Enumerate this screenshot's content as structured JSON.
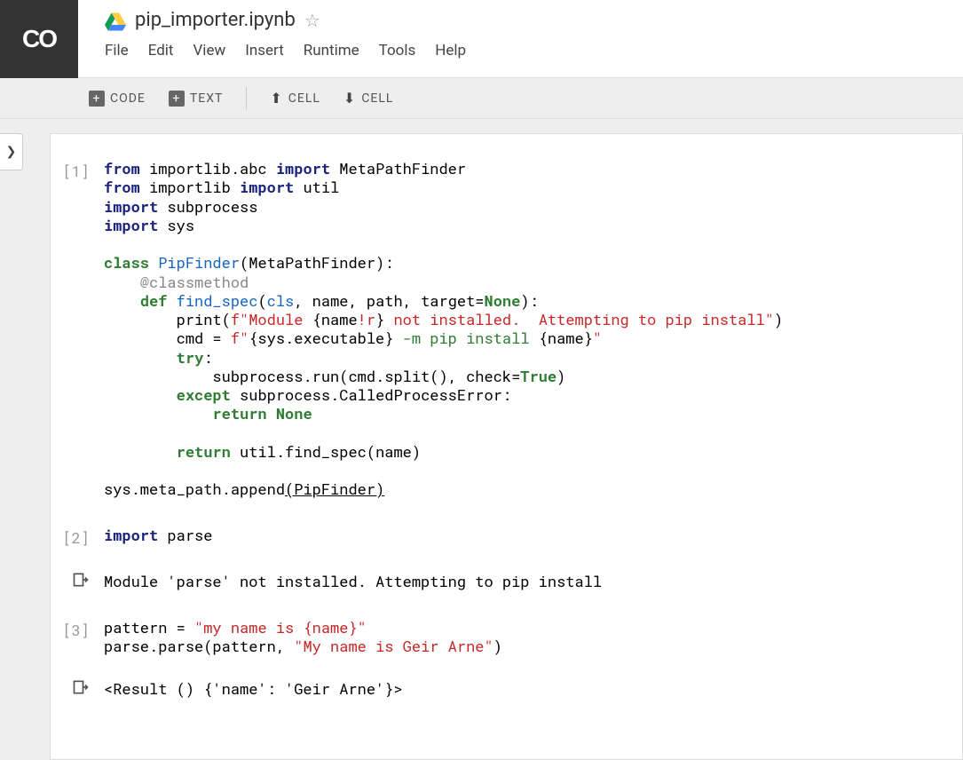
{
  "header": {
    "logo_text": "CO",
    "notebook_title": "pip_importer.ipynb"
  },
  "menu": {
    "file": "File",
    "edit": "Edit",
    "view": "View",
    "insert": "Insert",
    "runtime": "Runtime",
    "tools": "Tools",
    "help": "Help"
  },
  "toolbar": {
    "code": "CODE",
    "text": "TEXT",
    "cell_up": "CELL",
    "cell_down": "CELL"
  },
  "cells": [
    {
      "prompt": "[1]",
      "code_html": "<span class='kw'>from</span> importlib.abc <span class='kw'>import</span> MetaPathFinder\n<span class='kw'>from</span> importlib <span class='kw'>import</span> util\n<span class='kw'>import</span> subprocess\n<span class='kw'>import</span> sys\n\n<span class='kwg'>class</span> <span class='cls'>PipFinder</span>(MetaPathFinder):\n    <span class='deco'>@classmethod</span>\n    <span class='kwg'>def</span> <span class='fn'>find_spec</span>(<span class='param'>cls</span>, name, path, target=<span class='val'>None</span>):\n        print(<span class='str'>f\"Module </span>{name<span class='str'>!r</span>}<span class='str'> not installed.  Attempting to pip install\"</span>)\n        cmd = <span class='str'>f\"</span>{sys.executable}<span class='strg'> -m pip install </span>{name}<span class='str'>\"</span>\n        <span class='kwg'>try</span>:\n            subprocess.run(cmd.split(), check=<span class='val'>True</span>)\n        <span class='kwg'>except</span> subprocess.CalledProcessError:\n            <span class='kwg'>return</span> <span class='val'>None</span>\n\n        <span class='kwg'>return</span> util.find_spec(name)\n\nsys.meta_path.append<u>(PipFinder)</u>",
      "output": null
    },
    {
      "prompt": "[2]",
      "code_html": "<span class='kw'>import</span> parse",
      "output": "Module 'parse' not installed.  Attempting to pip install"
    },
    {
      "prompt": "[3]",
      "code_html": "pattern = <span class='str'>\"my name is {name}\"</span>\nparse.parse(pattern, <span class='str'>\"My name is Geir Arne\"</span>)",
      "output": "<Result () {'name': 'Geir Arne'}>"
    }
  ]
}
